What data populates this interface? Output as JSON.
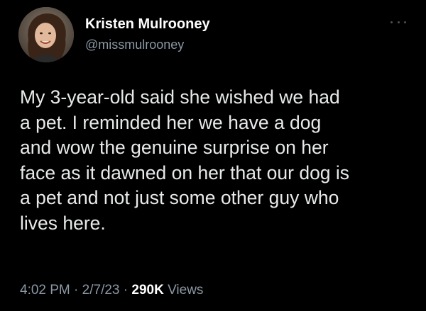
{
  "author": {
    "display_name": "Kristen Mulrooney",
    "handle": "@missmulrooney",
    "avatar_icon": "profile-photo"
  },
  "tweet": {
    "text_lines": [
      "My 3-year-old said she wished we had",
      "a pet. I reminded her we have a dog",
      "and wow the genuine surprise on her",
      "face as it dawned on her that our dog is",
      "a pet and not just some other guy who",
      "lives here."
    ]
  },
  "meta": {
    "time": "4:02 PM",
    "separator": "·",
    "date": "2/7/23",
    "views_count": "290K",
    "views_label": "Views"
  },
  "more_icon": "ellipsis-icon",
  "colors": {
    "background": "#000000",
    "text": "#e7e9ea",
    "secondary": "#8b98a5",
    "name": "#ffffff"
  }
}
